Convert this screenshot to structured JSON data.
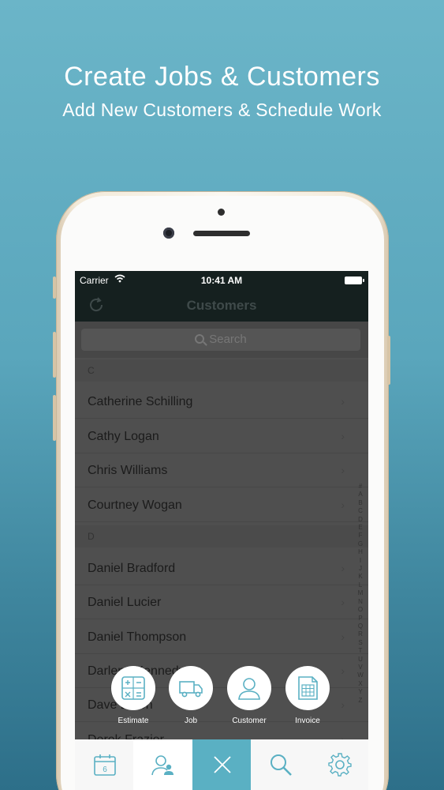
{
  "promo": {
    "title": "Create Jobs & Customers",
    "subtitle": "Add New Customers & Schedule Work"
  },
  "status_bar": {
    "carrier": "Carrier",
    "time": "10:41 AM"
  },
  "nav": {
    "title": "Customers"
  },
  "search": {
    "placeholder": "Search"
  },
  "sections": [
    {
      "letter": "C",
      "customers": [
        "Catherine Schilling",
        "Cathy Logan",
        "Chris Williams",
        "Courtney Wogan"
      ]
    },
    {
      "letter": "D",
      "customers": [
        "Daniel Bradford",
        "Daniel Lucier",
        "Daniel Thompson",
        "Darlene Kennedy",
        "Dave Dixon",
        "Derek Frazier"
      ]
    }
  ],
  "alpha_index": [
    "#",
    "A",
    "B",
    "C",
    "D",
    "E",
    "F",
    "G",
    "H",
    "I",
    "J",
    "K",
    "L",
    "M",
    "N",
    "O",
    "P",
    "Q",
    "R",
    "S",
    "T",
    "U",
    "V",
    "W",
    "X",
    "Y",
    "Z"
  ],
  "actions": [
    {
      "label": "Estimate",
      "icon": "calculator-icon"
    },
    {
      "label": "Job",
      "icon": "truck-icon"
    },
    {
      "label": "Customer",
      "icon": "person-icon"
    },
    {
      "label": "Invoice",
      "icon": "invoice-icon"
    }
  ],
  "tabs": [
    {
      "name": "calendar",
      "icon": "calendar-icon",
      "badge": "6"
    },
    {
      "name": "customers",
      "icon": "customers-icon"
    },
    {
      "name": "close",
      "icon": "close-icon"
    },
    {
      "name": "search",
      "icon": "search-icon"
    },
    {
      "name": "settings",
      "icon": "gear-icon"
    }
  ],
  "colors": {
    "accent": "#5ab0c3",
    "background_top": "#6bb5c8",
    "background_bottom": "#2d6f89",
    "nav_bar": "#15201f"
  }
}
